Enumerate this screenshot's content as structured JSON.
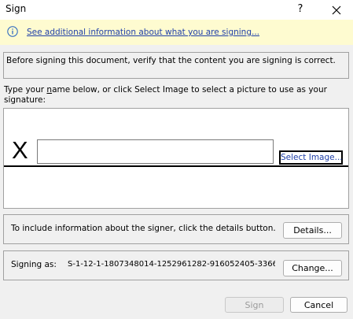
{
  "window": {
    "title": "Sign",
    "help_label": "?"
  },
  "info_bar": {
    "link_text": "See additional information about what you are signing..."
  },
  "verify": {
    "text": "Before signing this document, verify that the content you are signing is correct."
  },
  "instruction": {
    "part1": "Type your ",
    "name_word": "n",
    "part2": "ame below, or click Select Image to select a picture to use as your signature:"
  },
  "signature": {
    "x_mark": "X",
    "input_value": "",
    "select_image_label": "Select Image..."
  },
  "details": {
    "text": "To include information about the signer, click the details button.",
    "button_label": "Details..."
  },
  "signing": {
    "label": "Signing as:",
    "value": "S-1-12-1-1807348014-1252961282-916052405-3366...",
    "button_label": "Change..."
  },
  "footer": {
    "sign_label": "Sign",
    "cancel_label": "Cancel"
  },
  "colors": {
    "info_bar_bg": "#fefbd0",
    "link": "#1f3fa8",
    "dialog_bg": "#f0f0f0"
  }
}
